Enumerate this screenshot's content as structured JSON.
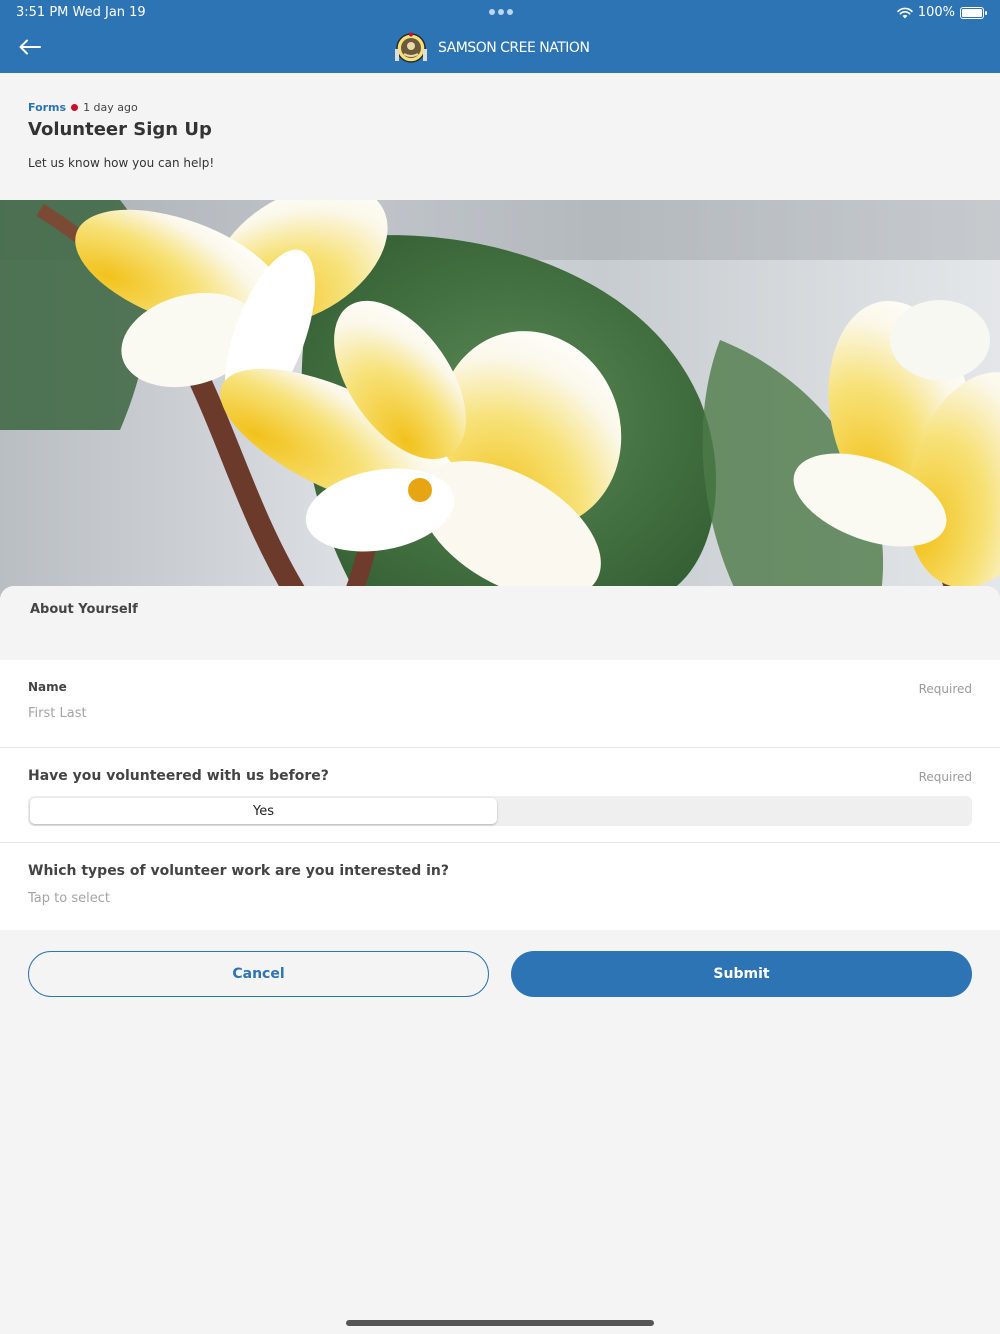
{
  "status_bar": {
    "time_date": "3:51 PM   Wed Jan 19",
    "battery": "100%",
    "battery_level": 1.0
  },
  "header": {
    "app_name": "SAMSON CREE NATION",
    "back_icon": "arrow-left-icon",
    "logo_icon": "nation-seal-icon"
  },
  "post": {
    "category": "Forms",
    "age": "1 day ago",
    "title": "Volunteer Sign Up",
    "subtitle": "Let us know how you can help!"
  },
  "form": {
    "section_title": "About Yourself",
    "name": {
      "label": "Name",
      "required": "Required",
      "placeholder": "First Last"
    },
    "volunteered_before": {
      "label": "Have you volunteered with us before?",
      "required": "Required",
      "selected_option": "Yes"
    },
    "work_types": {
      "label": "Which types of volunteer work are you interested in?",
      "placeholder": "Tap to select"
    }
  },
  "actions": {
    "cancel": "Cancel",
    "submit": "Submit"
  },
  "colors": {
    "brand_blue": "#2d74b4",
    "unread_dot": "#c8102e",
    "background": "#f4f4f4"
  }
}
